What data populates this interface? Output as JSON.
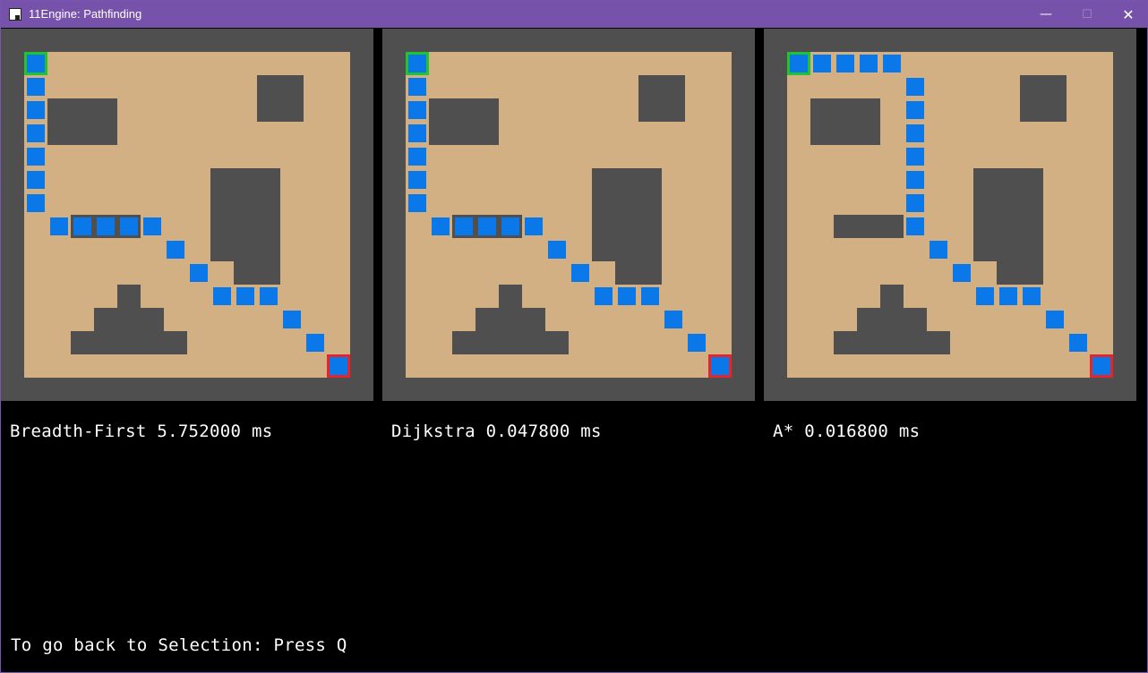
{
  "window": {
    "title": "11Engine: Pathfinding",
    "minimize_glyph": "—",
    "maximize_glyph": "☐",
    "close_glyph": "✕"
  },
  "icons": {
    "app": "app-window-icon"
  },
  "colors": {
    "titlebar": "#7652ab",
    "wall": "#4f4f4f",
    "floor": "#d2b084",
    "path": "#0a78e8",
    "start_border": "#21c42f",
    "goal_border": "#e3262e",
    "background": "#000000"
  },
  "grid": {
    "rows": 14,
    "cols": 14,
    "walls": [
      [
        1,
        2,
        3,
        2
      ],
      [
        10,
        1,
        2,
        2
      ],
      [
        2,
        7,
        3,
        1
      ],
      [
        8,
        5,
        3,
        4
      ],
      [
        9,
        9,
        2,
        1
      ],
      [
        4,
        10,
        1,
        1
      ],
      [
        3,
        11,
        3,
        1
      ],
      [
        2,
        12,
        5,
        1
      ]
    ],
    "start": [
      0,
      0
    ],
    "goal": [
      13,
      13
    ]
  },
  "panels": [
    {
      "algorithm": "Breadth-First",
      "time": "5.752000 ms",
      "label": "Breadth-First 5.752000 ms",
      "path": [
        [
          0,
          0
        ],
        [
          0,
          1
        ],
        [
          0,
          2
        ],
        [
          0,
          3
        ],
        [
          0,
          4
        ],
        [
          0,
          5
        ],
        [
          0,
          6
        ],
        [
          1,
          7
        ],
        [
          2,
          7
        ],
        [
          3,
          7
        ],
        [
          4,
          7
        ],
        [
          5,
          7
        ],
        [
          6,
          8
        ],
        [
          7,
          9
        ],
        [
          8,
          10
        ],
        [
          9,
          10
        ],
        [
          10,
          10
        ],
        [
          11,
          11
        ],
        [
          12,
          12
        ],
        [
          13,
          13
        ]
      ]
    },
    {
      "algorithm": "Dijkstra",
      "time": "0.047800 ms",
      "label": "Dijkstra 0.047800 ms",
      "path": [
        [
          0,
          0
        ],
        [
          0,
          1
        ],
        [
          0,
          2
        ],
        [
          0,
          3
        ],
        [
          0,
          4
        ],
        [
          0,
          5
        ],
        [
          0,
          6
        ],
        [
          1,
          7
        ],
        [
          2,
          7
        ],
        [
          3,
          7
        ],
        [
          4,
          7
        ],
        [
          5,
          7
        ],
        [
          6,
          8
        ],
        [
          7,
          9
        ],
        [
          8,
          10
        ],
        [
          9,
          10
        ],
        [
          10,
          10
        ],
        [
          11,
          11
        ],
        [
          12,
          12
        ],
        [
          13,
          13
        ]
      ]
    },
    {
      "algorithm": "A*",
      "time": "0.016800 ms",
      "label": "A* 0.016800 ms",
      "path": [
        [
          0,
          0
        ],
        [
          1,
          0
        ],
        [
          2,
          0
        ],
        [
          3,
          0
        ],
        [
          4,
          0
        ],
        [
          5,
          1
        ],
        [
          5,
          2
        ],
        [
          5,
          3
        ],
        [
          5,
          4
        ],
        [
          5,
          5
        ],
        [
          5,
          6
        ],
        [
          5,
          7
        ],
        [
          6,
          8
        ],
        [
          7,
          9
        ],
        [
          8,
          10
        ],
        [
          9,
          10
        ],
        [
          10,
          10
        ],
        [
          11,
          11
        ],
        [
          12,
          12
        ],
        [
          13,
          13
        ]
      ]
    }
  ],
  "footer": {
    "hint": "To go back to Selection: Press Q"
  }
}
